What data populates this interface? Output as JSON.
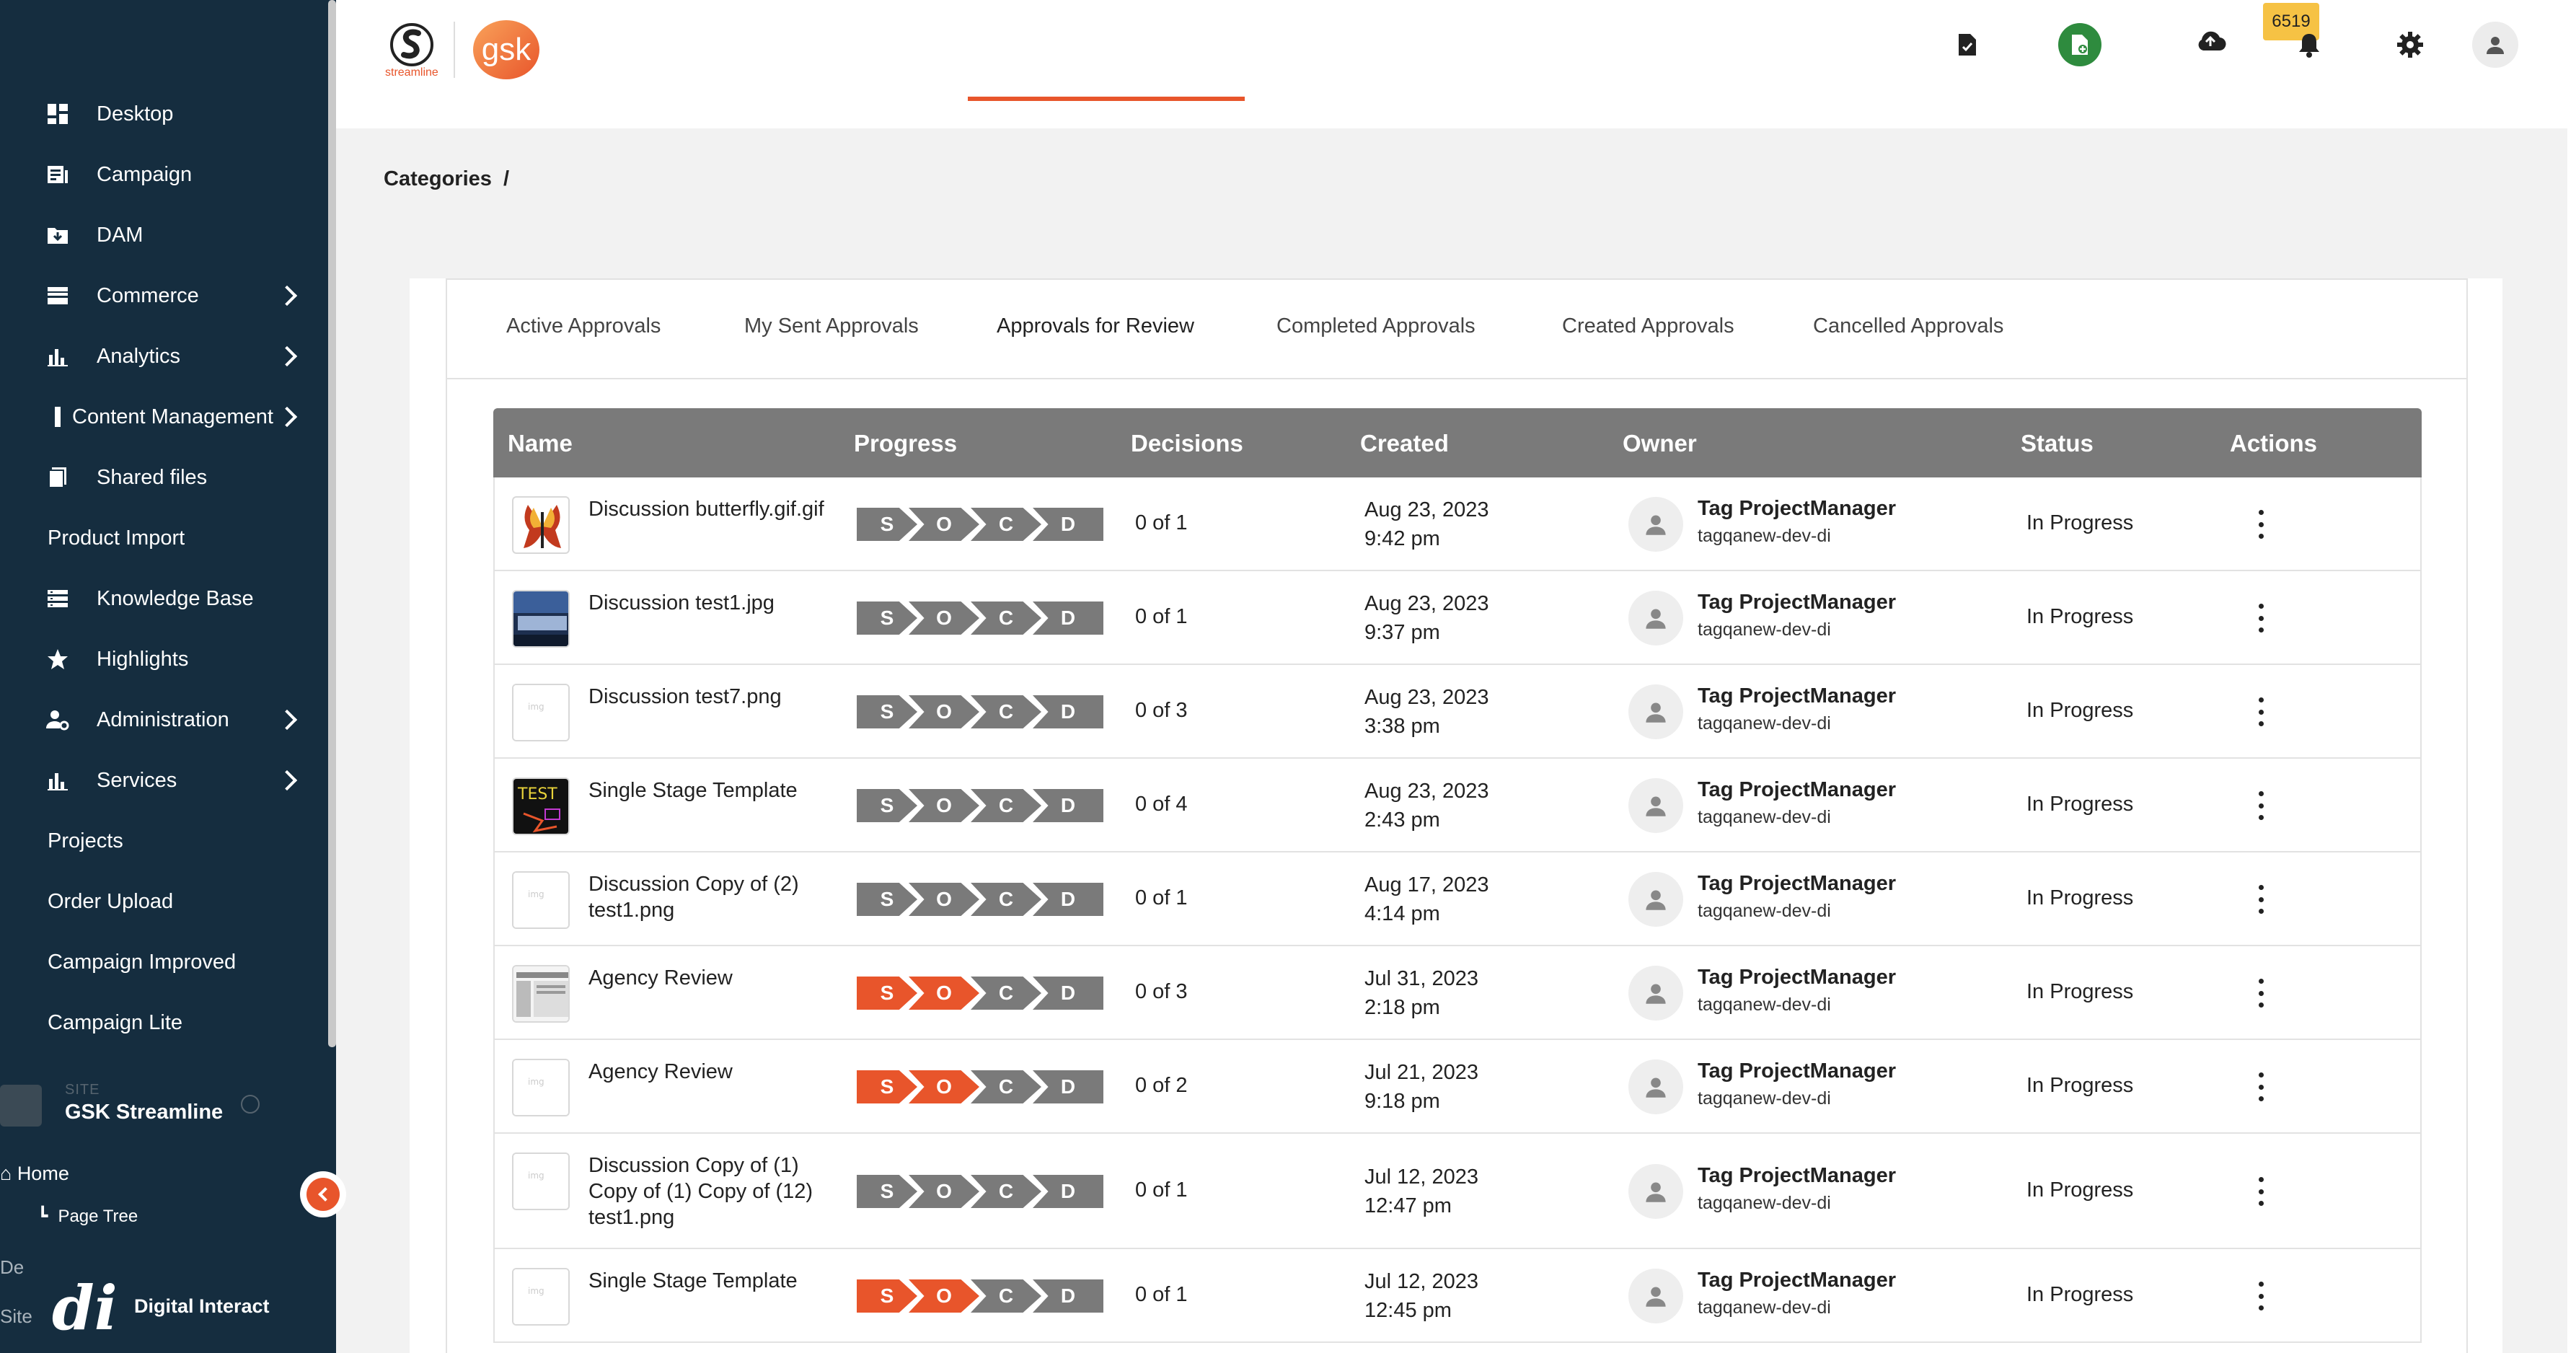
{
  "sidebar": {
    "items": [
      {
        "label": "Desktop",
        "icon": "dashboard-icon",
        "chevron": false
      },
      {
        "label": "Campaign",
        "icon": "campaign-icon",
        "chevron": false
      },
      {
        "label": "DAM",
        "icon": "folder-download-icon",
        "chevron": false
      },
      {
        "label": "Commerce",
        "icon": "commerce-icon",
        "chevron": true
      },
      {
        "label": "Analytics",
        "icon": "bar-chart-icon",
        "chevron": true
      },
      {
        "label": "Content Management",
        "icon": "content-icon",
        "chevron": true
      },
      {
        "label": "Shared files",
        "icon": "files-icon",
        "chevron": false
      },
      {
        "label": "Product Import",
        "icon": "",
        "chevron": false
      },
      {
        "label": "Knowledge Base",
        "icon": "list-icon",
        "chevron": false
      },
      {
        "label": "Highlights",
        "icon": "star-icon",
        "chevron": false
      },
      {
        "label": "Administration",
        "icon": "admin-icon",
        "chevron": true
      },
      {
        "label": "Services",
        "icon": "bar-chart-icon",
        "chevron": true
      },
      {
        "label": "Projects",
        "icon": "",
        "chevron": false
      },
      {
        "label": "Order Upload",
        "icon": "",
        "chevron": false
      },
      {
        "label": "Campaign Improved",
        "icon": "",
        "chevron": false
      },
      {
        "label": "Campaign Lite",
        "icon": "",
        "chevron": false
      }
    ],
    "site_label": "SITE",
    "site_name": "GSK Streamline",
    "home": "Home",
    "page_tree": "Page Tree",
    "de_fragment": "De",
    "site_fragment": "Site",
    "brand_logo": "di",
    "brand_name": "Digital Interact"
  },
  "header": {
    "logo_small_text": "streamline",
    "logo_gsk": "gsk",
    "notification_count": "6519",
    "colors": {
      "accent": "#e8552b",
      "green": "#2e8b3e",
      "badge": "#f6c244"
    }
  },
  "breadcrumb": {
    "item": "Categories",
    "separator": "/"
  },
  "tabs": [
    "Active Approvals",
    "My Sent Approvals",
    "Approvals for Review",
    "Completed Approvals",
    "Created Approvals",
    "Cancelled Approvals"
  ],
  "active_tab": "Approvals for Review",
  "table": {
    "headers": [
      "Name",
      "Progress",
      "Decisions",
      "Created",
      "Owner",
      "Status",
      "Actions"
    ],
    "stages": [
      "S",
      "O",
      "C",
      "D"
    ],
    "rows": [
      {
        "name": "Discussion butterfly.gif.gif",
        "active_stage": 0,
        "decisions": "0 of 1",
        "date": "Aug 23, 2023",
        "time": "9:42 pm",
        "owner": "Tag ProjectManager",
        "user": "tagqanew-dev-di",
        "status": "In Progress",
        "thumb": "butterfly"
      },
      {
        "name": "Discussion test1.jpg",
        "active_stage": 0,
        "decisions": "0 of 1",
        "date": "Aug 23, 2023",
        "time": "9:37 pm",
        "owner": "Tag ProjectManager",
        "user": "tagqanew-dev-di",
        "status": "In Progress",
        "thumb": "photo"
      },
      {
        "name": "Discussion test7.png",
        "active_stage": 0,
        "decisions": "0 of 3",
        "date": "Aug 23, 2023",
        "time": "3:38 pm",
        "owner": "Tag ProjectManager",
        "user": "tagqanew-dev-di",
        "status": "In Progress",
        "thumb": "blank"
      },
      {
        "name": "Single Stage Template",
        "active_stage": 0,
        "decisions": "0 of 4",
        "date": "Aug 23, 2023",
        "time": "2:43 pm",
        "owner": "Tag ProjectManager",
        "user": "tagqanew-dev-di",
        "status": "In Progress",
        "thumb": "test"
      },
      {
        "name": "Discussion Copy of (2) test1.png",
        "active_stage": 0,
        "decisions": "0 of 1",
        "date": "Aug 17, 2023",
        "time": "4:14 pm",
        "owner": "Tag ProjectManager",
        "user": "tagqanew-dev-di",
        "status": "In Progress",
        "thumb": "blank"
      },
      {
        "name": "Agency Review",
        "active_stage": 2,
        "decisions": "0 of 3",
        "date": "Jul 31, 2023",
        "time": "2:18 pm",
        "owner": "Tag ProjectManager",
        "user": "tagqanew-dev-di",
        "status": "In Progress",
        "thumb": "screen"
      },
      {
        "name": "Agency Review",
        "active_stage": 2,
        "decisions": "0 of 2",
        "date": "Jul 21, 2023",
        "time": "9:18 pm",
        "owner": "Tag ProjectManager",
        "user": "tagqanew-dev-di",
        "status": "In Progress",
        "thumb": "blank"
      },
      {
        "name": "Discussion Copy of (1) Copy of (1) Copy of (12) test1.png",
        "active_stage": 0,
        "decisions": "0 of 1",
        "date": "Jul 12, 2023",
        "time": "12:47 pm",
        "owner": "Tag ProjectManager",
        "user": "tagqanew-dev-di",
        "status": "In Progress",
        "thumb": "blank"
      },
      {
        "name": "Single Stage Template",
        "active_stage": 2,
        "decisions": "0 of 1",
        "date": "Jul 12, 2023",
        "time": "12:45 pm",
        "owner": "Tag ProjectManager",
        "user": "tagqanew-dev-di",
        "status": "In Progress",
        "thumb": "blank"
      }
    ]
  }
}
